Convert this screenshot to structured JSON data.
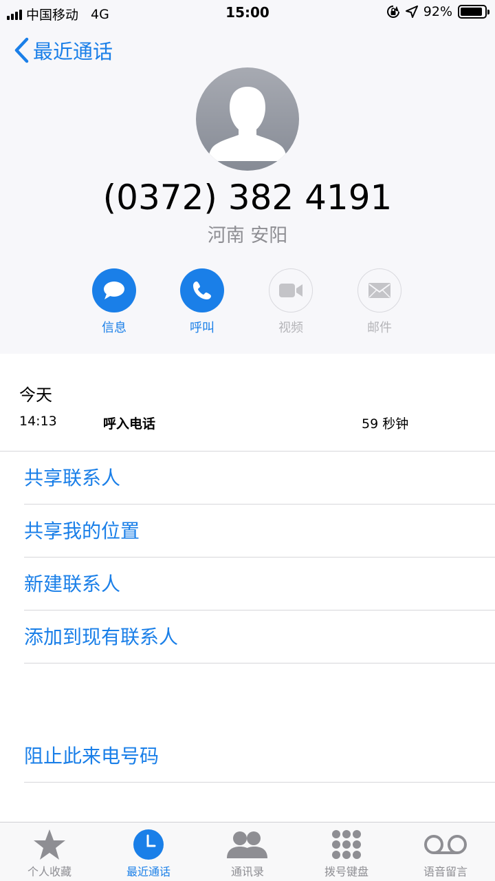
{
  "status_bar": {
    "carrier": "中国移动",
    "network": "4G",
    "time": "15:00",
    "battery": "92%",
    "battery_level": 0.92
  },
  "nav": {
    "back_label": "最近通话"
  },
  "contact": {
    "number": "(0372) 382 4191",
    "location": "河南 安阳"
  },
  "actions": [
    {
      "label": "信息",
      "icon": "message-icon",
      "enabled": true
    },
    {
      "label": "呼叫",
      "icon": "phone-icon",
      "enabled": true
    },
    {
      "label": "视频",
      "icon": "video-icon",
      "enabled": false
    },
    {
      "label": "邮件",
      "icon": "mail-icon",
      "enabled": false
    }
  ],
  "history": {
    "date": "今天",
    "entries": [
      {
        "time": "14:13",
        "type": "呼入电话",
        "duration": "59 秒钟"
      }
    ]
  },
  "options": [
    {
      "label": "共享联系人"
    },
    {
      "label": "共享我的位置"
    },
    {
      "label": "新建联系人"
    },
    {
      "label": "添加到现有联系人"
    }
  ],
  "block_option": {
    "label": "阻止此来电号码"
  },
  "tabs": [
    {
      "label": "个人收藏",
      "icon": "star-icon",
      "active": false
    },
    {
      "label": "最近通话",
      "icon": "clock-icon",
      "active": true
    },
    {
      "label": "通讯录",
      "icon": "contacts-icon",
      "active": false
    },
    {
      "label": "拨号键盘",
      "icon": "keypad-icon",
      "active": false
    },
    {
      "label": "语音留言",
      "icon": "voicemail-icon",
      "active": false
    }
  ],
  "colors": {
    "accent": "#1a7fe8",
    "header_bg": "#f7f7fa",
    "secondary_text": "#8e8e93",
    "disabled": "#b4b4b8"
  }
}
